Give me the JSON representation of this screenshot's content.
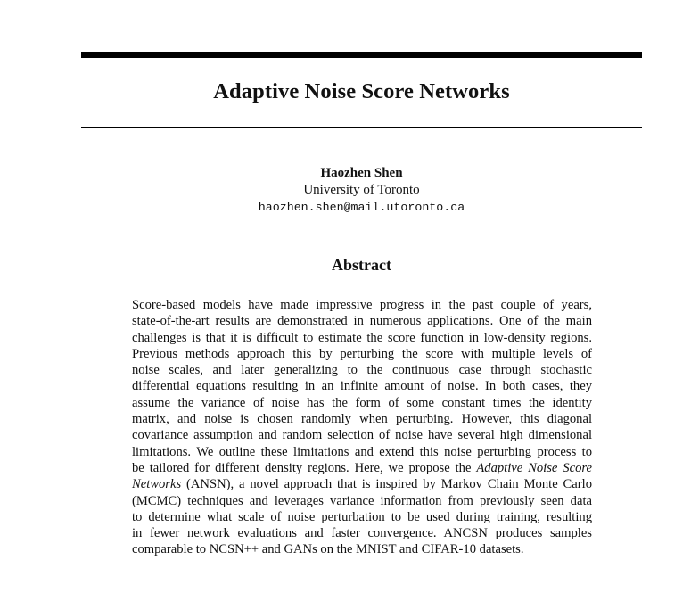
{
  "paper": {
    "title": "Adaptive Noise Score Networks",
    "author": {
      "name": "Haozhen Shen",
      "affiliation": "University of Toronto",
      "email": "haozhen.shen@mail.utoronto.ca"
    },
    "abstract_heading": "Abstract",
    "abstract_lines": [
      {
        "text": "Score-based models have made impressive progress in the past couple of years,"
      },
      {
        "text": "state-of-the-art results are demonstrated in numerous applications. One of the main"
      },
      {
        "text": "challenges is that it is difficult to estimate the score function in low-density regions."
      },
      {
        "text": "Previous methods approach this by perturbing the score with multiple levels of"
      },
      {
        "text": "noise scales, and later generalizing to the continuous case through stochastic"
      },
      {
        "text": "differential equations resulting in an infinite amount of noise. In both cases, they"
      },
      {
        "text": "assume the variance of noise has the form of some constant times the identity"
      },
      {
        "text": "matrix, and noise is chosen randomly when perturbing. However, this diagonal"
      },
      {
        "text": "covariance assumption and random selection of noise have several high dimensional"
      },
      {
        "text": "limitations. We outline these limitations and extend this noise perturbing process to"
      },
      {
        "pre": "be tailored for different density regions. Here, we propose the ",
        "em": "Adaptive Noise Score"
      },
      {
        "em": "Networks",
        "post": " (ANSN), a novel approach that is inspired by Markov Chain Monte Carlo"
      },
      {
        "text": "(MCMC) techniques and leverages variance information from previously seen data"
      },
      {
        "text": "to determine what scale of noise perturbation to be used during training, resulting"
      },
      {
        "text": "in fewer network evaluations and faster convergence. ANCSN produces samples"
      },
      {
        "text": "comparable to NCSN++ and GANs on the MNIST and CIFAR-10 datasets."
      }
    ]
  }
}
